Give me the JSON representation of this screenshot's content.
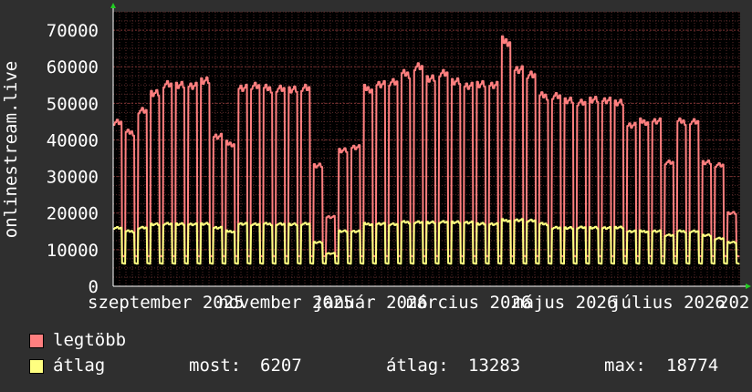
{
  "chart_data": {
    "type": "line",
    "ylabel": "onlinestream.live",
    "ylim": [
      0,
      75000
    ],
    "y_ticks": [
      0,
      10000,
      20000,
      30000,
      40000,
      50000,
      60000,
      70000
    ],
    "y_tick_labels": [
      "0",
      "10000",
      "20000",
      "30000",
      "40000",
      "50000",
      "60000",
      "70000"
    ],
    "x_tick_labels": [
      "szeptember 2025",
      "november 2025",
      "január 2026",
      "március 2026",
      "május 2026",
      "július 2026"
    ],
    "x_label_tail": "202",
    "grid": true,
    "legend_position": "bottom-left",
    "series": [
      {
        "name": "legtöbb",
        "color": "#ff7f7f",
        "weekly_peaks_approx": [
          45000,
          42000,
          48000,
          53000,
          55000,
          55000,
          55000,
          56000,
          41000,
          39000,
          54000,
          55000,
          54000,
          54000,
          54000,
          54000,
          33000,
          19000,
          37000,
          38000,
          54000,
          55000,
          56000,
          58000,
          60000,
          57000,
          58000,
          56000,
          55000,
          55000,
          55000,
          67000,
          59000,
          58000,
          52000,
          52000,
          51000,
          50000,
          51000,
          51000,
          50000,
          44000,
          45000,
          45000,
          34000,
          45000,
          45000,
          34000,
          33000,
          20000
        ],
        "weekend_low_approx": 8000
      },
      {
        "name": "átlag",
        "color": "#ffff80",
        "weekly_peaks_approx": [
          16000,
          15000,
          16000,
          17000,
          17000,
          17000,
          17000,
          17000,
          16000,
          15000,
          17000,
          17000,
          17000,
          17000,
          17000,
          17000,
          12000,
          9000,
          15000,
          15000,
          17000,
          17000,
          17000,
          17500,
          17500,
          17500,
          17500,
          17500,
          17500,
          17000,
          17000,
          18000,
          18000,
          18000,
          17000,
          16000,
          16000,
          16000,
          16000,
          16000,
          16000,
          15000,
          15000,
          15000,
          14000,
          15000,
          15000,
          14000,
          13000,
          12000
        ],
        "weekend_low_approx": 6000
      }
    ]
  },
  "legend": {
    "items": [
      {
        "label": "legtöbb",
        "color": "#ff7f7f"
      },
      {
        "label": "átlag",
        "color": "#ffff80"
      }
    ],
    "stats": {
      "current_label": "most:",
      "current_value": "6207",
      "avg_label": "átlag:",
      "avg_value": "13283",
      "max_label": "max:",
      "max_value": "18774"
    }
  },
  "colors": {
    "background": "#2f2f2f",
    "plot_bg": "#000000",
    "grid_minor": "#5a2a2a",
    "grid_major": "#7a3030",
    "axis_arrow": "#22cc22",
    "text": "#ffffff"
  }
}
